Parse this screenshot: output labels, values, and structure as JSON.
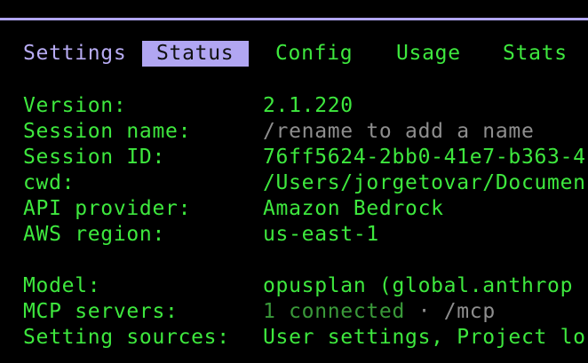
{
  "tabs": {
    "settings": "Settings",
    "status": "Status",
    "config": "Config",
    "usage": "Usage",
    "stats": "Stats"
  },
  "rows": [
    {
      "label": "Version:",
      "value": "2.1.220"
    },
    {
      "label": "Session name:",
      "value": "/rename to add a name"
    },
    {
      "label": "Session ID:",
      "value": "76ff5624-2bb0-41e7-b363-4"
    },
    {
      "label": "cwd:",
      "value": "/Users/jorgetovar/Documen"
    },
    {
      "label": "API provider:",
      "value": "Amazon Bedrock"
    },
    {
      "label": "AWS region:",
      "value": "us-east-1"
    },
    {
      "label": "Model:",
      "value": "opusplan (global.anthrop"
    },
    {
      "label": "MCP servers:",
      "value_count": "1 connected",
      "value_sep": " · ",
      "value_name": "/mcp"
    },
    {
      "label": "Setting sources:",
      "value": "User settings, Project lo"
    }
  ],
  "colors": {
    "accent": "#b1a6f2",
    "text": "#3ee83e",
    "muted": "#8e8e8e",
    "background": "#000000"
  }
}
